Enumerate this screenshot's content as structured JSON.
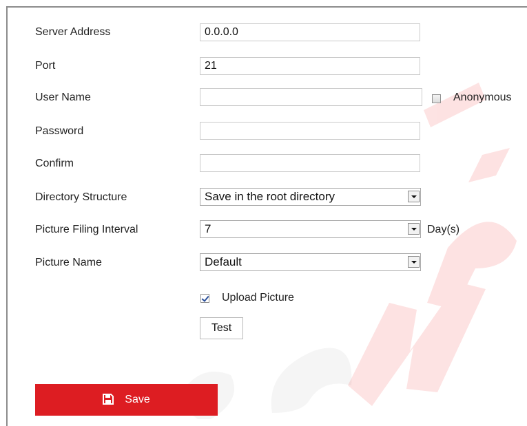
{
  "form": {
    "server_address": {
      "label": "Server Address",
      "value": "0.0.0.0"
    },
    "port": {
      "label": "Port",
      "value": "21"
    },
    "user_name": {
      "label": "User Name",
      "value": "",
      "anonymous_label": "Anonymous",
      "anonymous_checked": false
    },
    "password": {
      "label": "Password",
      "value": ""
    },
    "confirm": {
      "label": "Confirm",
      "value": ""
    },
    "directory_structure": {
      "label": "Directory Structure",
      "selected": "Save in the root directory"
    },
    "picture_filing_interval": {
      "label": "Picture Filing Interval",
      "selected": "7",
      "unit": "Day(s)"
    },
    "picture_name": {
      "label": "Picture Name",
      "selected": "Default"
    },
    "upload_picture": {
      "label": "Upload Picture",
      "checked": true
    },
    "test_button": "Test",
    "save_button": "Save"
  },
  "colors": {
    "save_button_bg": "#dd1d22",
    "watermark": "#ef1b1b"
  },
  "icons": {
    "save": "floppy-disk-icon",
    "checkbox_checked": "checkmark-icon",
    "dropdown": "chevron-down-icon"
  }
}
